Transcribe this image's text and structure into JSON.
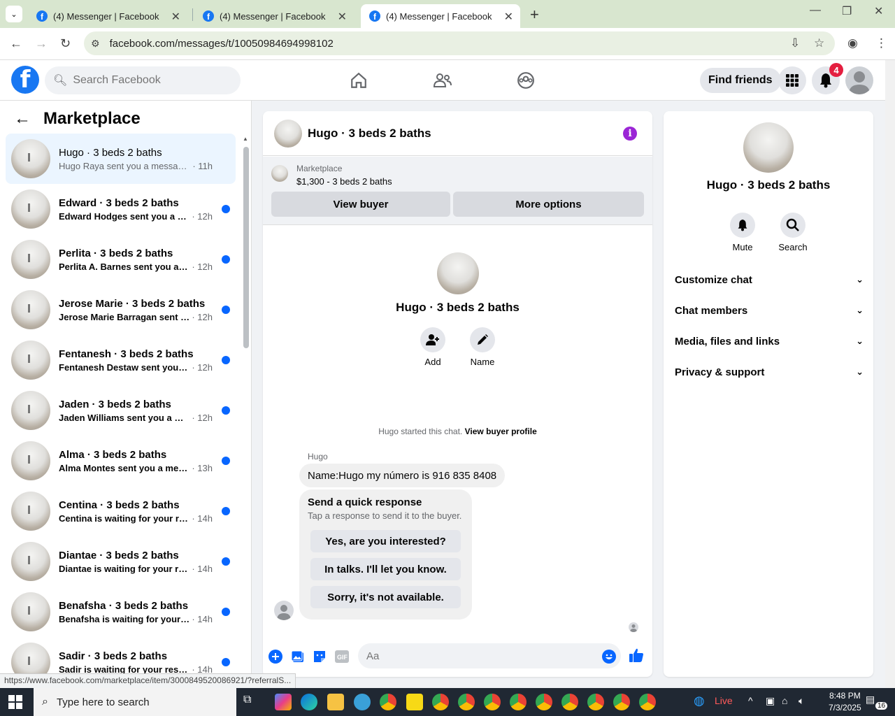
{
  "browser": {
    "tabs": [
      {
        "title": "(4) Messenger | Facebook"
      },
      {
        "title": "(4) Messenger | Facebook"
      },
      {
        "title": "(4) Messenger | Facebook"
      }
    ],
    "url": "facebook.com/messages/t/10050984694998102"
  },
  "header": {
    "search_placeholder": "Search Facebook",
    "find_friends": "Find friends",
    "notification_count": "4"
  },
  "sidebar": {
    "title": "Marketplace",
    "conversations": [
      {
        "name": "Hugo · 3 beds 2 baths",
        "preview": "Hugo Raya sent you a message a...",
        "time": "· 11h"
      },
      {
        "name": "Edward · 3 beds 2 baths",
        "preview": "Edward Hodges sent you a me...",
        "time": "· 12h"
      },
      {
        "name": "Perlita · 3 beds 2 baths",
        "preview": "Perlita A. Barnes sent you a me...",
        "time": "· 12h"
      },
      {
        "name": "Jerose Marie · 3 beds 2 baths",
        "preview": "Jerose Marie Barragan sent yo...",
        "time": "· 12h"
      },
      {
        "name": "Fentanesh · 3 beds 2 baths",
        "preview": "Fentanesh Destaw sent you a ...",
        "time": "· 12h"
      },
      {
        "name": "Jaden · 3 beds 2 baths",
        "preview": "Jaden Williams sent you a mes...",
        "time": "· 12h"
      },
      {
        "name": "Alma · 3 beds 2 baths",
        "preview": "Alma Montes sent you a messa...",
        "time": "· 13h"
      },
      {
        "name": "Centina · 3 beds 2 baths",
        "preview": "Centina is waiting for your res...",
        "time": "· 14h"
      },
      {
        "name": "Diantae · 3 beds 2 baths",
        "preview": "Diantae is waiting for your res...",
        "time": "· 14h"
      },
      {
        "name": "Benafsha · 3 beds 2 baths",
        "preview": "Benafsha is waiting for your re...",
        "time": "· 14h"
      },
      {
        "name": "Sadir · 3 beds 2 baths",
        "preview": "Sadir is waiting for your respo...",
        "time": "· 14h"
      }
    ]
  },
  "chat": {
    "title": "Hugo · 3 beds 2 baths",
    "marketplace_label": "Marketplace",
    "listing": "$1,300 - 3 beds 2 baths",
    "view_buyer": "View buyer",
    "more_options": "More options",
    "profile_name": "Hugo · 3 beds 2 baths",
    "add_label": "Add",
    "name_label": "Name",
    "started_text": "Hugo started this chat.",
    "view_buyer_profile": "View buyer profile",
    "sender": "Hugo",
    "message": "Name:Hugo my número is 916 835 8408",
    "quick_title": "Send a quick response",
    "quick_sub": "Tap a response to send it to the buyer.",
    "quick_options": [
      "Yes, are you interested?",
      "In talks. I'll let you know.",
      "Sorry, it's not available."
    ],
    "composer_placeholder": "Aa"
  },
  "details": {
    "name": "Hugo · 3 beds 2 baths",
    "mute": "Mute",
    "search": "Search",
    "sections": [
      "Customize chat",
      "Chat members",
      "Media, files and links",
      "Privacy & support"
    ]
  },
  "status_link": "https://www.facebook.com/marketplace/item/3000849520086921/?referralS...",
  "taskbar": {
    "search_placeholder": "Type here to search",
    "live": "Live",
    "time": "8:48 PM",
    "date": "7/3/2025",
    "notifications": "16"
  },
  "colors": {
    "brand": "#1877f2",
    "unread_dot": "#0866ff",
    "badge": "#e41e3f"
  }
}
